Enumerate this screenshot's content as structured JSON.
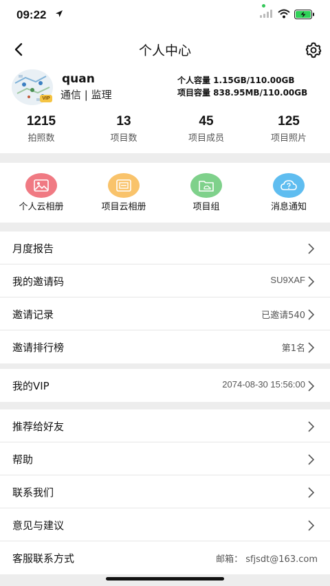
{
  "status": {
    "time": "09:22"
  },
  "nav": {
    "title": "个人中心"
  },
  "profile": {
    "username": "quan",
    "role": "通信 | 监理",
    "vip_badge": "VIP",
    "personal_storage": "个人容量 1.15GB/110.00GB",
    "project_storage": "项目容量 838.95MB/110.00GB"
  },
  "stats": [
    {
      "value": "1215",
      "label": "拍照数"
    },
    {
      "value": "13",
      "label": "项目数"
    },
    {
      "value": "45",
      "label": "项目成员"
    },
    {
      "value": "125",
      "label": "项目照片"
    }
  ],
  "shortcuts": [
    {
      "label": "个人云相册",
      "icon": "photo-icon",
      "color": "#f07a83"
    },
    {
      "label": "项目云相册",
      "icon": "album-icon",
      "color": "#f9c36b"
    },
    {
      "label": "项目组",
      "icon": "folder-icon",
      "color": "#7fd18b"
    },
    {
      "label": "消息通知",
      "icon": "cloud-question-icon",
      "color": "#5fbdf0"
    }
  ],
  "menu_group_1": [
    {
      "label": "月度报告",
      "value": ""
    },
    {
      "label": "我的邀请码",
      "value": "SU9XAF"
    },
    {
      "label": "邀请记录",
      "value": "已邀请540"
    },
    {
      "label": "邀请排行榜",
      "value": "第1名"
    }
  ],
  "menu_group_2": [
    {
      "label": "我的VIP",
      "value": "2074-08-30 15:56:00"
    }
  ],
  "menu_group_3": [
    {
      "label": "推荐给好友",
      "value": ""
    },
    {
      "label": "帮助",
      "value": ""
    },
    {
      "label": "联系我们",
      "value": ""
    },
    {
      "label": "意见与建议",
      "value": ""
    },
    {
      "label": "客服联系方式",
      "value": "邮箱： sfjsdt@163.com"
    }
  ]
}
